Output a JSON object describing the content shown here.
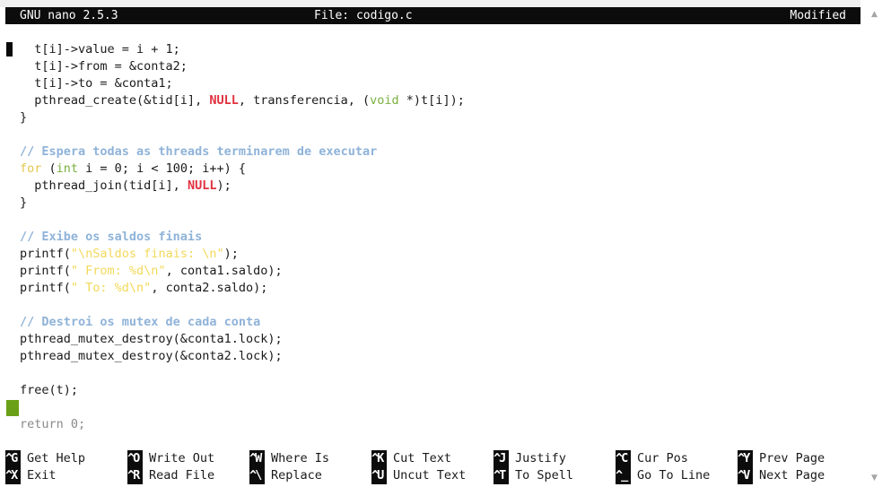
{
  "titlebar": {
    "version": "GNU nano 2.5.3",
    "file": "File: codigo.c",
    "status": "Modified"
  },
  "code": {
    "l1": "  t[i]->value = i + 1;",
    "l2": "  t[i]->from = &conta2;",
    "l3": "  t[i]->to = &conta1;",
    "l4a": "  pthread_create(&tid[i], ",
    "l4null": "NULL",
    "l4b": ", transferencia, (",
    "l4void": "void",
    "l4c": " *)t[i]);",
    "l5": "}",
    "l6": "// Espera todas as threads terminarem de executar",
    "l7for": "for",
    "l7a": " (",
    "l7int": "int",
    "l7b": " i = 0; i < 100; i++) {",
    "l8a": "  pthread_join(tid[i], ",
    "l8null": "NULL",
    "l8b": ");",
    "l9": "}",
    "l10": "// Exibe os saldos finais",
    "l11a": "printf(",
    "l11str": "\"\\nSaldos finais: \\n\"",
    "l11b": ");",
    "l12a": "printf(",
    "l12str": "\" From: %d\\n\"",
    "l12b": ", conta1.saldo);",
    "l13a": "printf(",
    "l13str": "\" To: %d\\n\"",
    "l13b": ", conta2.saldo);",
    "l14": "// Destroi os mutex de cada conta",
    "l15": "pthread_mutex_destroy(&conta1.lock);",
    "l16": "pthread_mutex_destroy(&conta2.lock);",
    "l17": "free(t);",
    "l18": "return 0;"
  },
  "shortcuts": [
    {
      "key": "^G",
      "label": "Get Help"
    },
    {
      "key": "^O",
      "label": "Write Out"
    },
    {
      "key": "^W",
      "label": "Where Is"
    },
    {
      "key": "^K",
      "label": "Cut Text"
    },
    {
      "key": "^J",
      "label": "Justify"
    },
    {
      "key": "^C",
      "label": "Cur Pos"
    },
    {
      "key": "^Y",
      "label": "Prev Page"
    },
    {
      "key": "^X",
      "label": "Exit"
    },
    {
      "key": "^R",
      "label": "Read File"
    },
    {
      "key": "^\\",
      "label": "Replace"
    },
    {
      "key": "^U",
      "label": "Uncut Text"
    },
    {
      "key": "^T",
      "label": "To Spell"
    },
    {
      "key": "^_",
      "label": "Go To Line"
    },
    {
      "key": "^V",
      "label": "Next Page"
    }
  ],
  "scrollbar": {
    "up_icon": "▲",
    "down_icon": "▼"
  }
}
